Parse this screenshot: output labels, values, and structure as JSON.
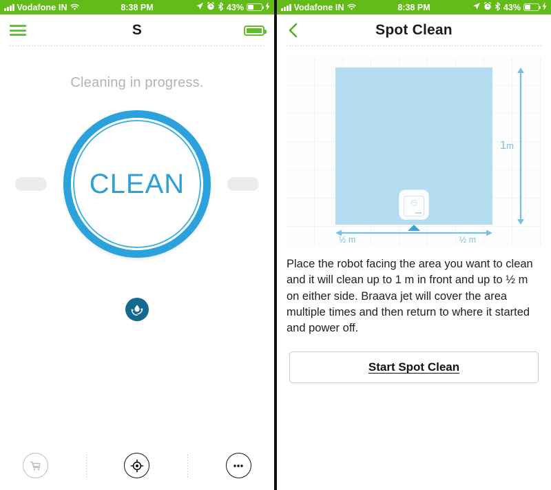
{
  "status_bar": {
    "carrier": "Vodafone IN",
    "time": "8:38 PM",
    "battery_pct": "43%",
    "icons": [
      "signal-bars-icon",
      "wifi-icon",
      "location-arrow-icon",
      "alarm-clock-icon",
      "bluetooth-icon",
      "battery-icon",
      "charging-bolt-icon"
    ],
    "bg_color": "#62bb19"
  },
  "left_panel": {
    "nav": {
      "menu_icon": "hamburger-menu-icon",
      "title": "S",
      "battery_icon": "battery-full-icon",
      "accent_color": "#63bb2a"
    },
    "status_message": "Cleaning in progress.",
    "clean_button": {
      "label": "CLEAN",
      "ring_color": "#2ba2dc",
      "text_color": "#2f9fd6"
    },
    "side_pills": {
      "left": "pill-handle-left",
      "right": "pill-handle-right",
      "color": "#ececec"
    },
    "water_icon": {
      "name": "water-drop-refresh-icon",
      "color": "#15688f"
    },
    "tabbar": {
      "items": [
        {
          "name": "tab-store",
          "icon": "shopping-cart-icon",
          "active": false
        },
        {
          "name": "tab-spot-clean",
          "icon": "target-spot-icon",
          "active": true
        },
        {
          "name": "tab-more",
          "icon": "more-dots-icon",
          "active": true
        }
      ]
    }
  },
  "right_panel": {
    "nav": {
      "back_icon": "back-chevron-icon",
      "title": "Spot Clean",
      "accent_color": "#63bb2a"
    },
    "diagram": {
      "area_color": "#b3dcf0",
      "arrow_color": "#7bc0e0",
      "vertical_label": "1",
      "vertical_unit": "m",
      "left_label": "½ m",
      "right_label": "½ m",
      "robot": "braava-jet-robot-icon"
    },
    "body_text": "Place the robot facing the area you want to clean and it will clean up to 1 m in front and up to ½ m on either side. Braava jet will cover the area multiple times and then return to where it started and power off.",
    "start_button_label": "Start Spot Clean"
  }
}
